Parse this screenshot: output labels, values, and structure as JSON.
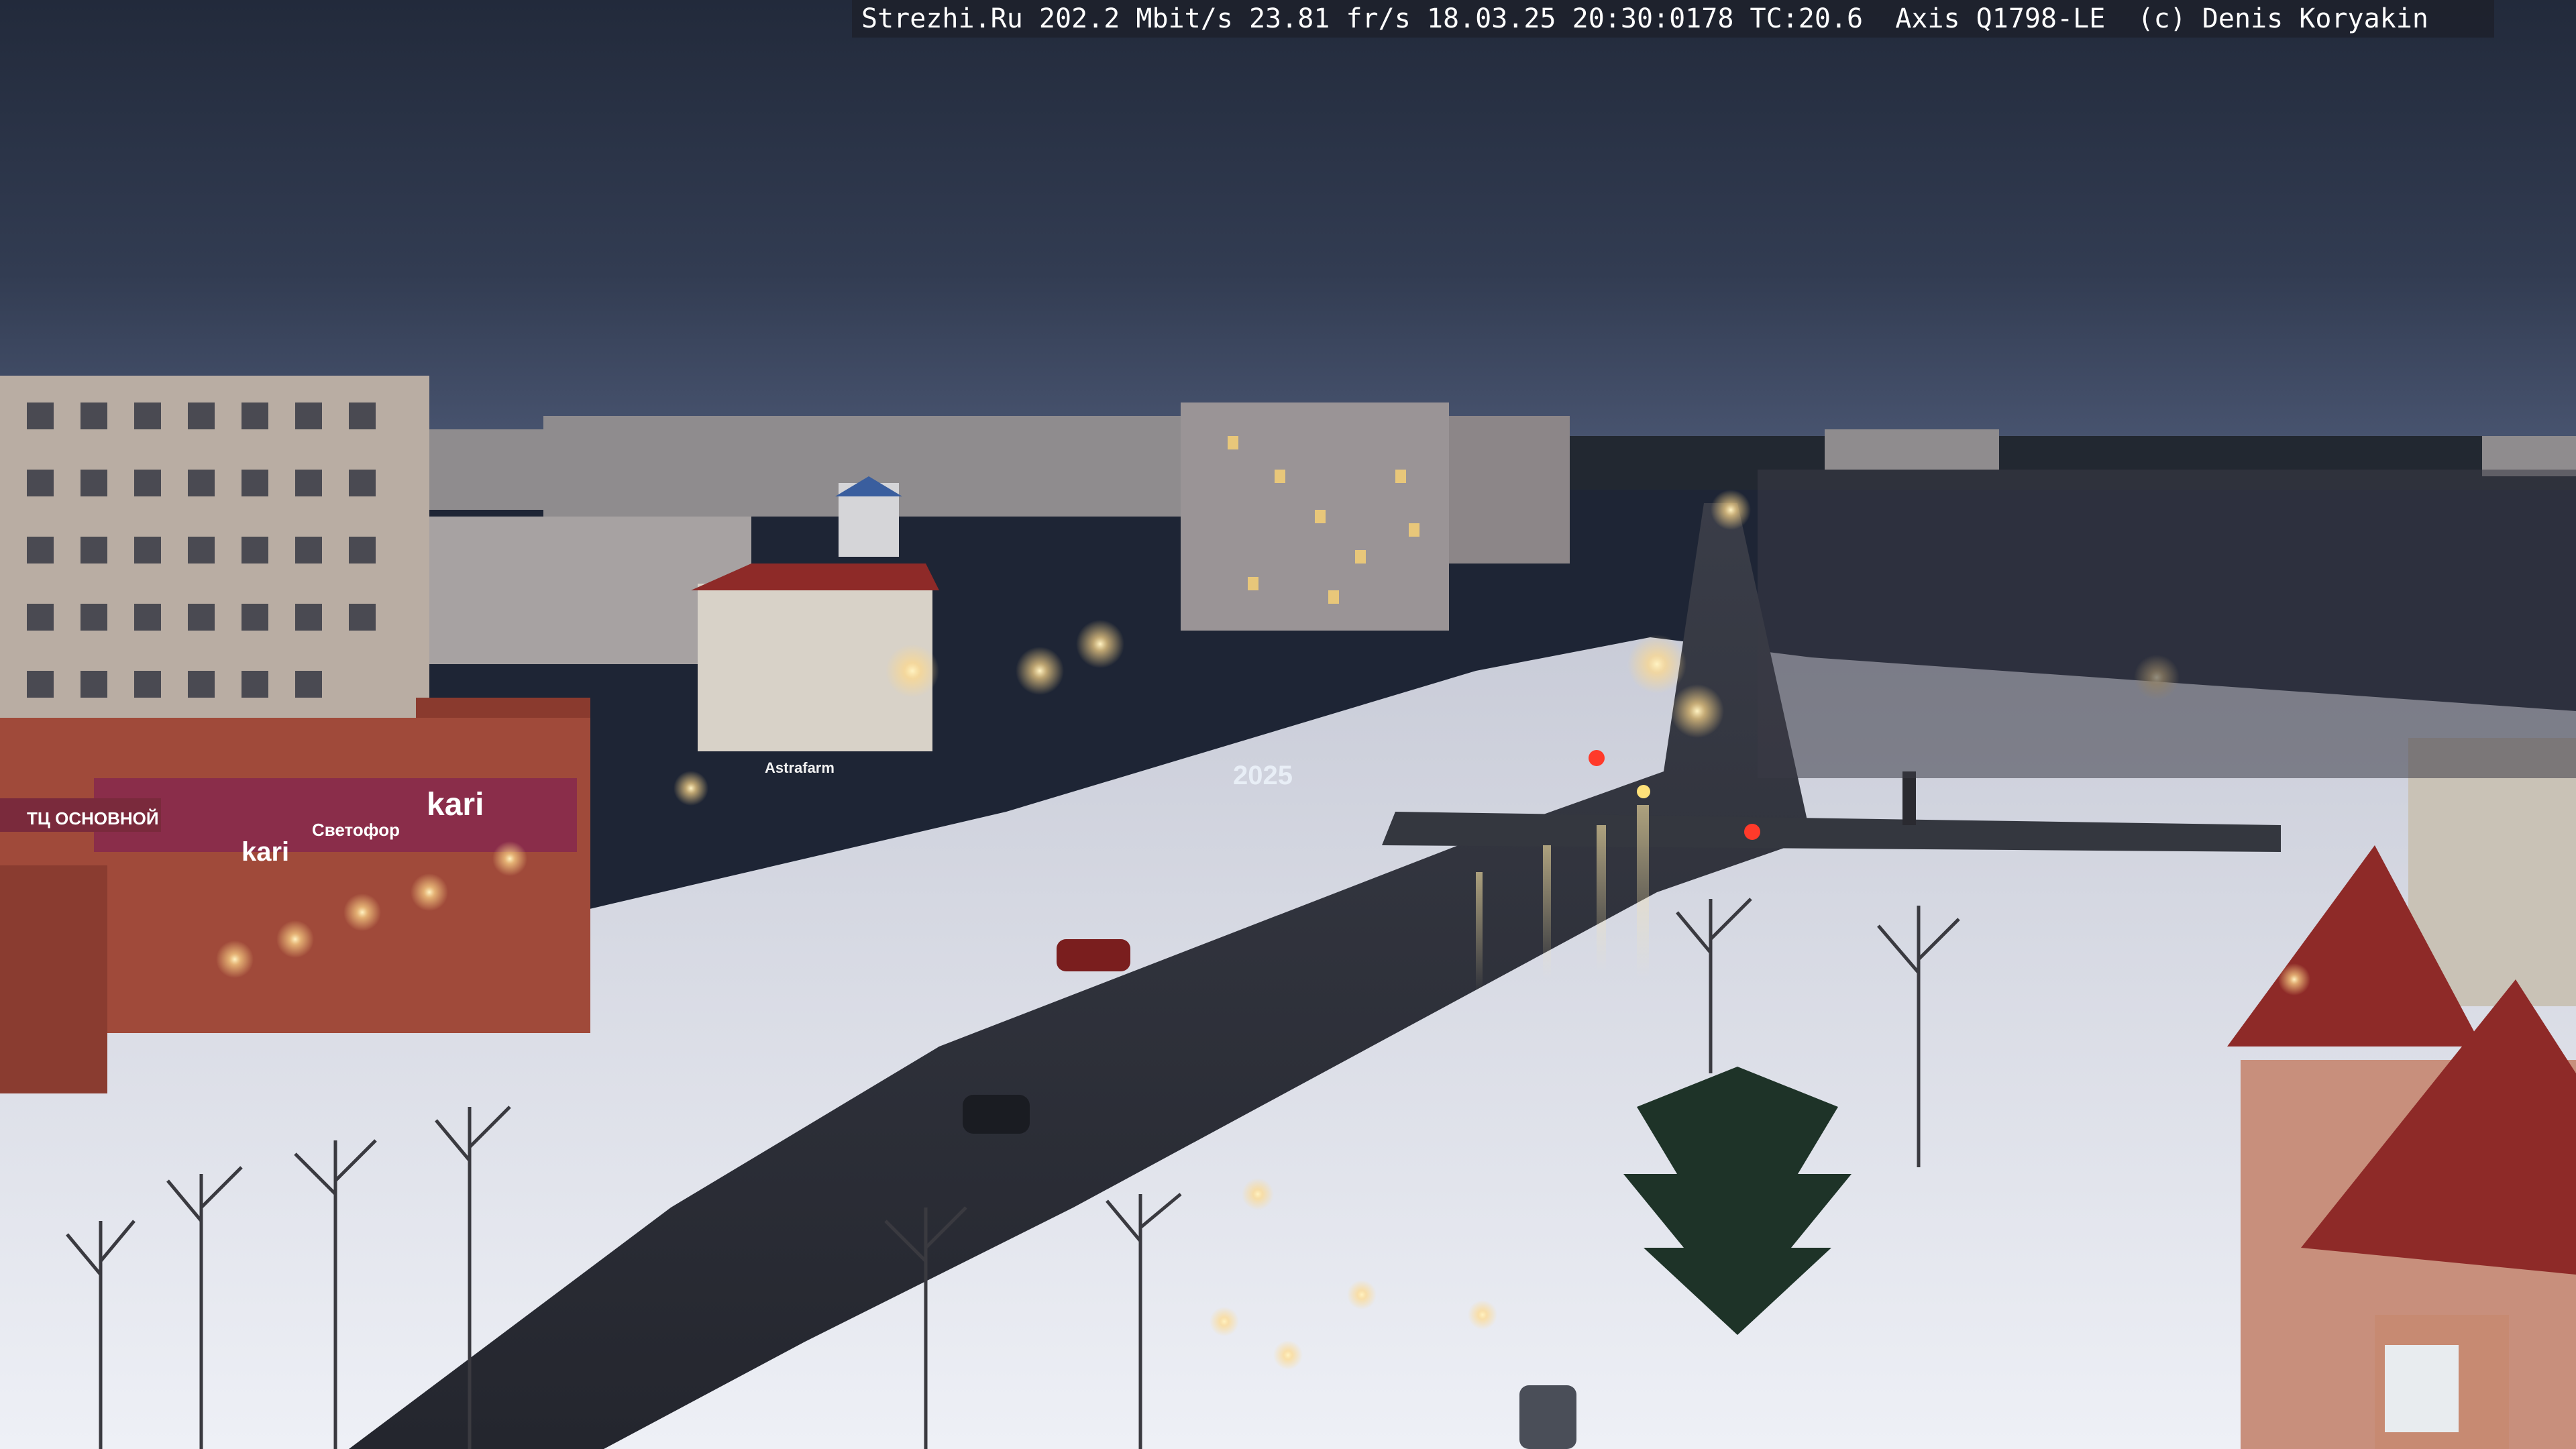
{
  "overlay": {
    "text": "Strezhi.Ru 202.2 Mbit/s 23.81 fr/s 18.03.25 20:30:0178 TC:20.6  Axis Q1798-LE  (c) Denis Koryakin"
  },
  "signs": {
    "left_store": "ТЦ ОСНОВНОЙ",
    "kari_main": "kari",
    "kari_secondary": "kari",
    "banner": "Светофор",
    "billboard": "Astrafarm",
    "snow_year": "2025"
  },
  "colors": {
    "sky_top": "#222a3b",
    "sky_horizon": "#4a5672",
    "snow": "#e3e6f0",
    "road": "#2b2e38",
    "store_facade": "#a04a3a",
    "roof_red": "#8e2a28",
    "lamp_glow": "#ffd98a"
  }
}
